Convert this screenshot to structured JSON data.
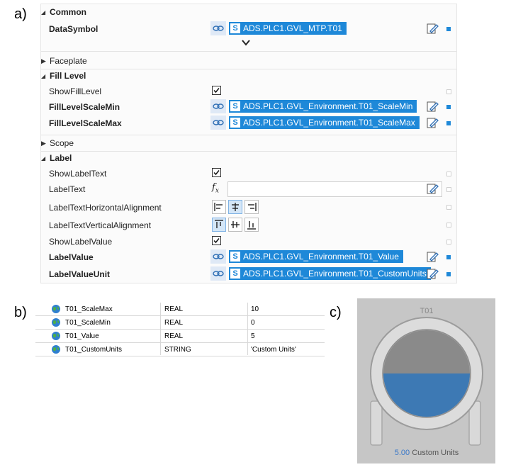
{
  "labels": {
    "a": "a)",
    "b": "b)",
    "c": "c)"
  },
  "property_grid": {
    "common": {
      "header": "Common",
      "data_symbol": {
        "label": "DataSymbol",
        "badge": "S",
        "value": "ADS.PLC1.GVL_MTP.T01"
      }
    },
    "faceplate": {
      "header": "Faceplate"
    },
    "fill_level": {
      "header": "Fill Level",
      "show_fill_level": {
        "label": "ShowFillLevel",
        "checked": true
      },
      "scale_min": {
        "label": "FillLevelScaleMin",
        "badge": "S",
        "value": "ADS.PLC1.GVL_Environment.T01_ScaleMin"
      },
      "scale_max": {
        "label": "FillLevelScaleMax",
        "badge": "S",
        "value": "ADS.PLC1.GVL_Environment.T01_ScaleMax"
      }
    },
    "scope": {
      "header": "Scope"
    },
    "label": {
      "header": "Label",
      "show_label_text": {
        "label": "ShowLabelText",
        "checked": true
      },
      "label_text": {
        "label": "LabelText",
        "value": ""
      },
      "h_align": {
        "label": "LabelTextHorizontalAlignment",
        "selected": "center"
      },
      "v_align": {
        "label": "LabelTextVerticalAlignment",
        "selected": "top"
      },
      "show_label_value": {
        "label": "ShowLabelValue",
        "checked": true
      },
      "label_value": {
        "label": "LabelValue",
        "badge": "S",
        "value": "ADS.PLC1.GVL_Environment.T01_Value"
      },
      "label_value_unit": {
        "label": "LabelValueUnit",
        "badge": "S",
        "value": "ADS.PLC1.GVL_Environment.T01_CustomUnits"
      }
    }
  },
  "variables": [
    {
      "name": "T01_ScaleMax",
      "type": "REAL",
      "value": "10"
    },
    {
      "name": "T01_ScaleMin",
      "type": "REAL",
      "value": "0"
    },
    {
      "name": "T01_Value",
      "type": "REAL",
      "value": "5"
    },
    {
      "name": "T01_CustomUnits",
      "type": "STRING",
      "value": "'Custom Units'"
    }
  ],
  "tank": {
    "title": "T01",
    "value": "5.00",
    "unit": "Custom Units",
    "fill_fraction": 0.5,
    "colors": {
      "fill": "#3d79b4",
      "empty": "#8a8a8a",
      "value_text": "#3a78c8"
    }
  },
  "colors": {
    "accent": "#1e88d8",
    "link_bg": "#dfe9f6"
  }
}
